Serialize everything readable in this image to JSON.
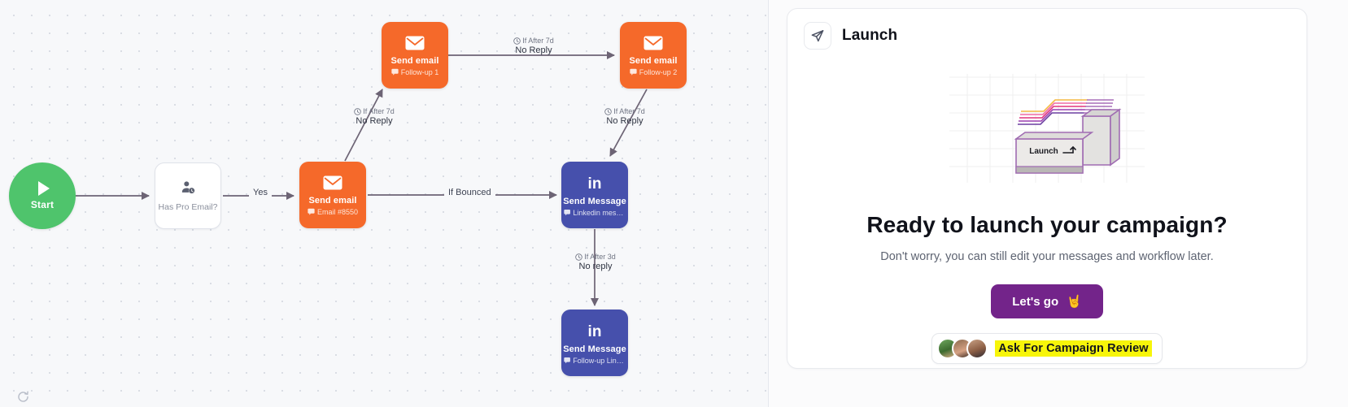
{
  "canvas": {
    "nodes": [
      {
        "id": "start",
        "kind": "start",
        "title": "Start",
        "subtitle": ""
      },
      {
        "id": "cond",
        "kind": "condition",
        "title": "Has Pro Email?",
        "subtitle": ""
      },
      {
        "id": "email_main",
        "kind": "email",
        "title": "Send email",
        "subtitle": "Email #8550"
      },
      {
        "id": "email_f1",
        "kind": "email",
        "title": "Send email",
        "subtitle": "Follow-up 1"
      },
      {
        "id": "email_f2",
        "kind": "email",
        "title": "Send email",
        "subtitle": "Follow-up 2"
      },
      {
        "id": "li_main",
        "kind": "linkedin",
        "title": "Send Message",
        "subtitle": "Linkedin messa..."
      },
      {
        "id": "li_f1",
        "kind": "linkedin",
        "title": "Send Message",
        "subtitle": "Follow-up Linke..."
      }
    ],
    "edges": [
      {
        "id": "e_start_cond",
        "label": ""
      },
      {
        "id": "e_cond_email",
        "label": "Yes"
      },
      {
        "id": "e_email_f1",
        "condition": "If After 7d",
        "label": "No Reply"
      },
      {
        "id": "e_f1_f2",
        "condition": "If After 7d",
        "label": "No Reply"
      },
      {
        "id": "e_f2_li",
        "condition": "If After 7d",
        "label": "No Reply"
      },
      {
        "id": "e_email_li",
        "label": "If Bounced"
      },
      {
        "id": "e_li_lif1",
        "condition": "If After 3d",
        "label": "No reply"
      }
    ],
    "colors": {
      "email": "#f5692a",
      "linkedin": "#4650ac",
      "start": "#4fc46c",
      "edge": "#6d6475",
      "background": "#f7f8fa"
    }
  },
  "panel": {
    "title": "Launch",
    "headline": "Ready to launch your campaign?",
    "subline": "Don't worry, you can still edit your messages and workflow later.",
    "primary_button": {
      "label": "Let's go",
      "emoji": "🤘"
    },
    "review_button": {
      "label": "Ask For Campaign Review",
      "highlight_color": "#f7f50a"
    },
    "illustration": {
      "key_label": "Launch"
    }
  }
}
